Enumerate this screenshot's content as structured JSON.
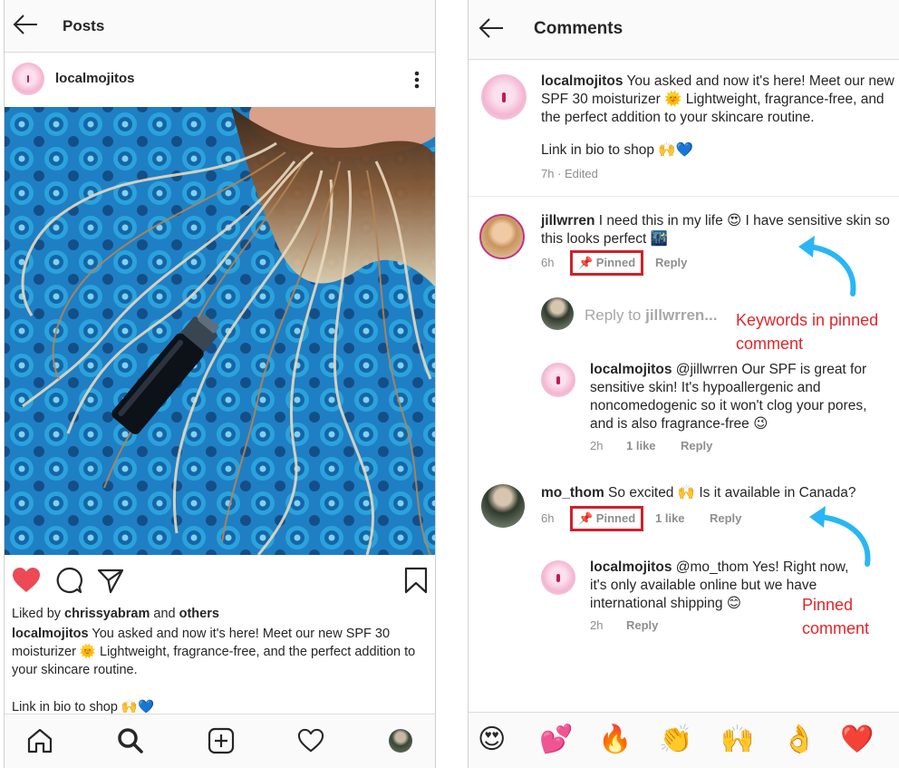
{
  "left": {
    "header": {
      "title": "Posts"
    },
    "post": {
      "username": "localmojitos",
      "liked_by": {
        "prefix": "Liked by ",
        "user": "chrissyabram",
        "middle": " and ",
        "others": "others"
      },
      "caption": {
        "user": "localmojitos",
        "text": " You asked and now it's here! Meet our new SPF 30 moisturizer 🌞 Lightweight, fragrance-free, and the perfect addition to your skincare routine."
      },
      "link_line": "Link in bio to shop 🙌💙"
    },
    "nav": [
      "home-icon",
      "search-icon",
      "add-icon",
      "heart-icon",
      "profile-avatar"
    ]
  },
  "right": {
    "header": {
      "title": "Comments"
    },
    "caption": {
      "user": "localmojitos",
      "text": " You asked and now it's here! Meet our new SPF 30 moisturizer 🌞 Lightweight, fragrance-free, and the perfect addition to your skincare routine.",
      "link_line": "Link in bio to shop 🙌💙",
      "meta": "7h · Edited"
    },
    "comment1": {
      "user": "jillwrren",
      "text": " I need this in my life 😍 I have sensitive skin so this looks perfect 🌃",
      "time": "6h",
      "pinned": "📌 Pinned",
      "reply": "Reply"
    },
    "reply_input": {
      "prefix": "Reply to ",
      "user": "jillwrren..."
    },
    "reply1": {
      "user": "localmojitos",
      "text": " @jillwrren Our SPF is great for sensitive skin! It's hypoallergenic and noncomedogenic so it won't clog your pores, and is also fragrance-free 😉",
      "time": "2h",
      "likes": "1 like",
      "reply": "Reply"
    },
    "comment2": {
      "user": "mo_thom",
      "text": " So excited 🙌 Is it available in Canada?",
      "time": "6h",
      "pinned": "📌 Pinned",
      "likes": "1 like",
      "reply": "Reply"
    },
    "reply2": {
      "user": "localmojitos",
      "text": " @mo_thom Yes! Right now, it's only available online but we have international shipping 😊",
      "time": "2h",
      "reply": "Reply"
    },
    "annotations": {
      "keywords": "Keywords in pinned comment",
      "pinned": "Pinned comment"
    },
    "emojis": [
      "😍",
      "💕",
      "🔥",
      "👏",
      "🙌",
      "👌",
      "❤️"
    ],
    "colors": {
      "annotation": "#e0262c",
      "arrow": "#29b6f6",
      "pinned_box": "#d0202a",
      "like": "#ed4956"
    }
  }
}
